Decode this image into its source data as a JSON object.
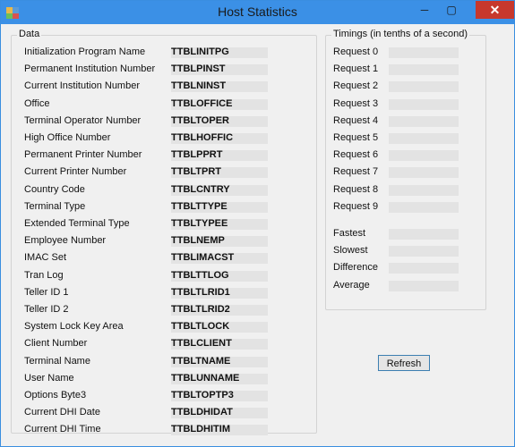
{
  "window": {
    "title": "Host Statistics",
    "close_glyph": "✕",
    "minimize_glyph": "─",
    "maximize_glyph": "▢"
  },
  "data_group": {
    "legend": "Data",
    "rows": [
      {
        "label": "Initialization Program Name",
        "code": "TTBLINITPG"
      },
      {
        "label": "Permanent Institution Number",
        "code": "TTBLPINST"
      },
      {
        "label": "Current Institution Number",
        "code": "TTBLNINST"
      },
      {
        "label": "Office",
        "code": "TTBLOFFICE"
      },
      {
        "label": "Terminal Operator Number",
        "code": "TTBLTOPER"
      },
      {
        "label": "High Office Number",
        "code": "TTBLHOFFIC"
      },
      {
        "label": "Permanent Printer Number",
        "code": "TTBLPPRT"
      },
      {
        "label": "Current Printer Number",
        "code": "TTBLTPRT"
      },
      {
        "label": "Country Code",
        "code": "TTBLCNTRY"
      },
      {
        "label": "Terminal Type",
        "code": "TTBLTTYPE"
      },
      {
        "label": "Extended Terminal Type",
        "code": "TTBLTYPEE"
      },
      {
        "label": "Employee Number",
        "code": "TTBLNEMP"
      },
      {
        "label": "IMAC Set",
        "code": "TTBLIMACST"
      },
      {
        "label": "Tran Log",
        "code": "TTBLTTLOG"
      },
      {
        "label": "Teller ID 1",
        "code": "TTBLTLRID1"
      },
      {
        "label": "Teller ID 2",
        "code": "TTBLTLRID2"
      },
      {
        "label": "System Lock Key Area",
        "code": "TTBLTLOCK"
      },
      {
        "label": "Client Number",
        "code": "TTBLCLIENT"
      },
      {
        "label": "Terminal Name",
        "code": "TTBLTNAME"
      },
      {
        "label": "User Name",
        "code": "TTBLUNNAME"
      },
      {
        "label": "Options Byte3",
        "code": "TTBLTOPTP3"
      },
      {
        "label": "Current DHI Date",
        "code": "TTBLDHIDAT"
      },
      {
        "label": "Current DHI Time",
        "code": "TTBLDHITIM"
      }
    ]
  },
  "timings_group": {
    "legend": "Timings (in tenths of a second)",
    "requests": [
      "Request 0",
      "Request 1",
      "Request 2",
      "Request 3",
      "Request 4",
      "Request 5",
      "Request 6",
      "Request 7",
      "Request 8",
      "Request 9"
    ],
    "stats": [
      "Fastest",
      "Slowest",
      "Difference",
      "Average"
    ]
  },
  "refresh_label": "Refresh"
}
